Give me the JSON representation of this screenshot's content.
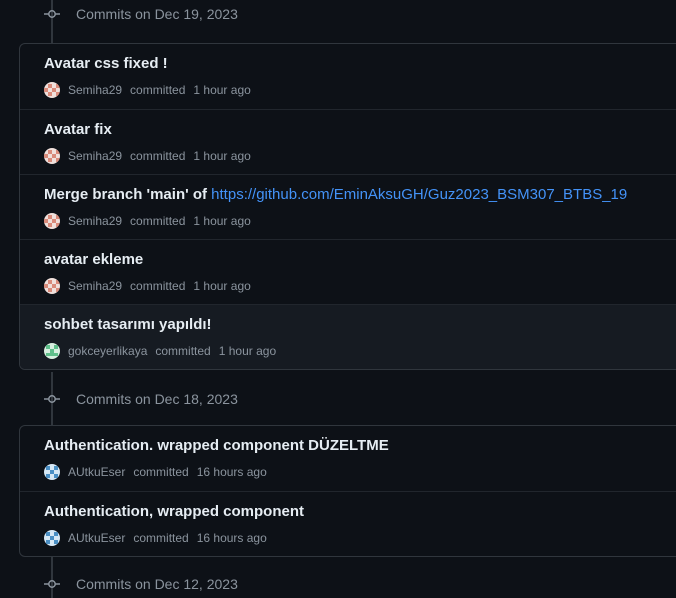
{
  "date_groups": [
    {
      "label": "Commits on Dec 19, 2023",
      "commits": [
        {
          "title": "Avatar css fixed !",
          "author": "Semiha29",
          "verb": "committed",
          "time": "1 hour ago",
          "avatar": "avatar-checker"
        },
        {
          "title": "Avatar fix",
          "author": "Semiha29",
          "verb": "committed",
          "time": "1 hour ago",
          "avatar": "avatar-checker"
        },
        {
          "title": "Merge branch 'main' of ",
          "link": "https://github.com/EminAksuGH/Guz2023_BSM307_BTBS_19",
          "author": "Semiha29",
          "verb": "committed",
          "time": "1 hour ago",
          "avatar": "avatar-checker"
        },
        {
          "title": "avatar ekleme",
          "author": "Semiha29",
          "verb": "committed",
          "time": "1 hour ago",
          "avatar": "avatar-checker"
        },
        {
          "title": "sohbet tasarımı yapıldı!",
          "author": "gokceyerlikaya",
          "verb": "committed",
          "time": "1 hour ago",
          "avatar": "avatar-green"
        }
      ]
    },
    {
      "label": "Commits on Dec 18, 2023",
      "commits": [
        {
          "title": "Authentication. wrapped component DÜZELTME",
          "author": "AUtkuEser",
          "verb": "committed",
          "time": "16 hours ago",
          "avatar": "avatar-blue"
        },
        {
          "title": "Authentication, wrapped component",
          "author": "AUtkuEser",
          "verb": "committed",
          "time": "16 hours ago",
          "avatar": "avatar-blue"
        }
      ]
    },
    {
      "label": "Commits on Dec 12, 2023",
      "commits": []
    }
  ],
  "colors": {
    "background": "#0d1117",
    "border": "#30363d",
    "link": "#4493f8",
    "muted": "#8b949e",
    "text": "#e6edf3"
  }
}
